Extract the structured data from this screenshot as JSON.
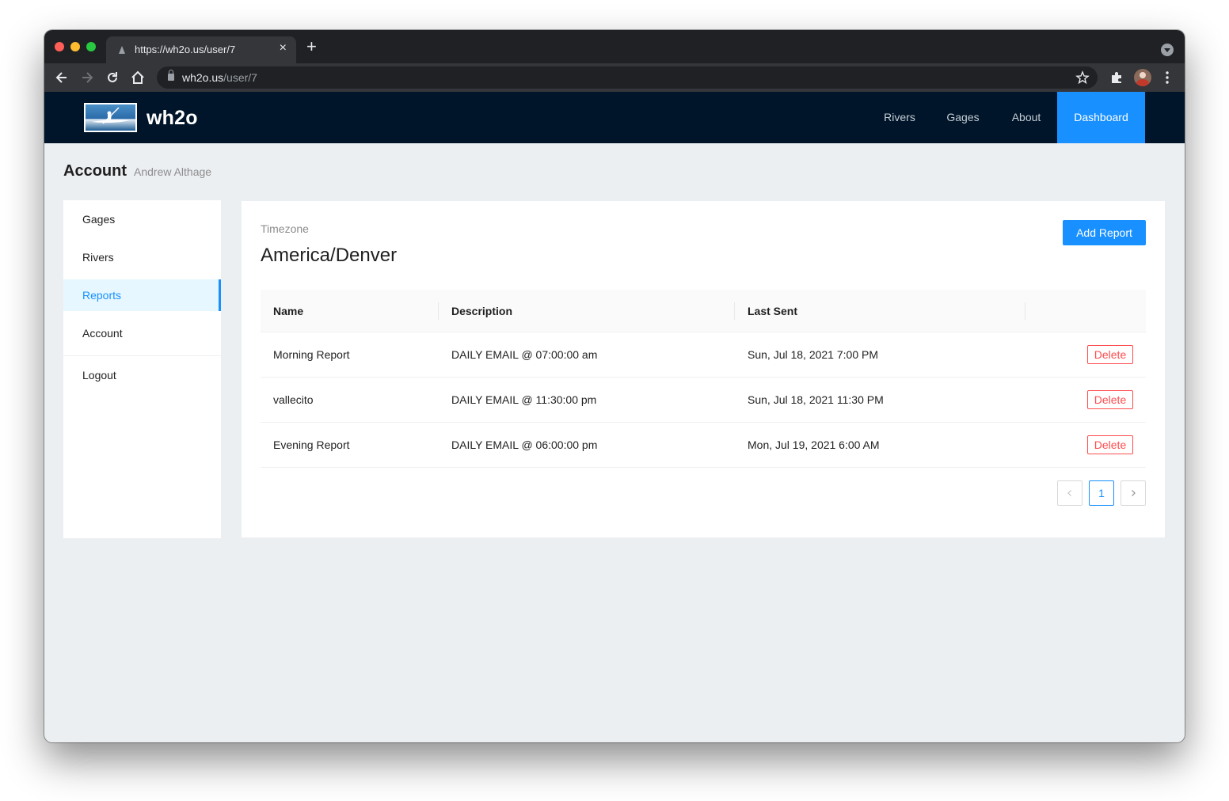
{
  "browser": {
    "tab_title": "https://wh2o.us/user/7",
    "url_host": "wh2o.us",
    "url_path": "/user/7",
    "new_tab_symbol": "+",
    "tab_close_symbol": "×"
  },
  "app": {
    "brand": "wh2o",
    "nav": [
      "Rivers",
      "Gages",
      "About",
      "Dashboard"
    ],
    "active_nav": "Dashboard",
    "accent_color": "#1890ff",
    "nav_background": "#001529"
  },
  "page": {
    "title": "Account",
    "subtitle": "Andrew Althage"
  },
  "sidebar": {
    "items": [
      "Gages",
      "Rivers",
      "Reports",
      "Account",
      "Logout"
    ],
    "active": "Reports"
  },
  "content": {
    "timezone_label": "Timezone",
    "timezone_value": "America/Denver",
    "add_button": "Add Report",
    "columns": [
      "Name",
      "Description",
      "Last Sent",
      ""
    ],
    "rows": [
      {
        "name": "Morning Report",
        "description": "DAILY EMAIL @ 07:00:00 am",
        "last_sent": "Sun, Jul 18, 2021 7:00 PM",
        "action": "Delete"
      },
      {
        "name": "vallecito",
        "description": "DAILY EMAIL @ 11:30:00 pm",
        "last_sent": "Sun, Jul 18, 2021 11:30 PM",
        "action": "Delete"
      },
      {
        "name": "Evening Report",
        "description": "DAILY EMAIL @ 06:00:00 pm",
        "last_sent": "Mon, Jul 19, 2021 6:00 AM",
        "action": "Delete"
      }
    ],
    "pagination": {
      "prev": "<",
      "current": "1",
      "next": ">"
    }
  }
}
